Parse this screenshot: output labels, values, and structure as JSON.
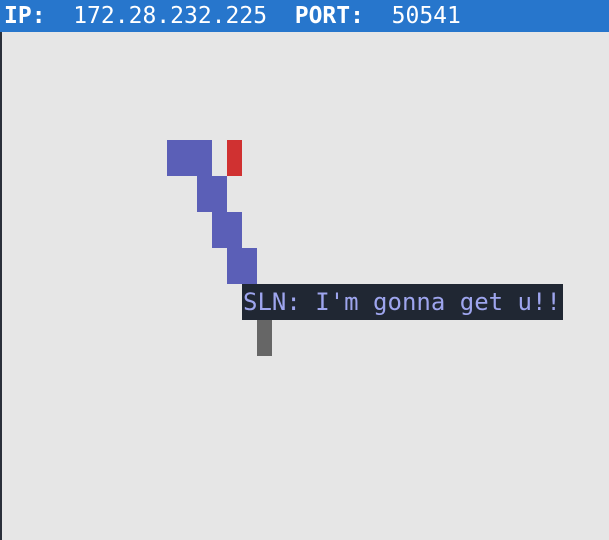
{
  "header": {
    "ip_label": "IP:",
    "ip_value": "172.28.232.225",
    "port_label": "PORT:",
    "port_value": "50541"
  },
  "chat": {
    "message": "SLN: I'm gonna get u!!"
  },
  "colors": {
    "header_background": "#2776cc",
    "board_background": "#e6e6e6",
    "player_snake": "#5b5fb7",
    "food": "#d03131",
    "other_snake": "#666666",
    "chat_background": "#202733",
    "chat_text": "#9ea5ee"
  }
}
